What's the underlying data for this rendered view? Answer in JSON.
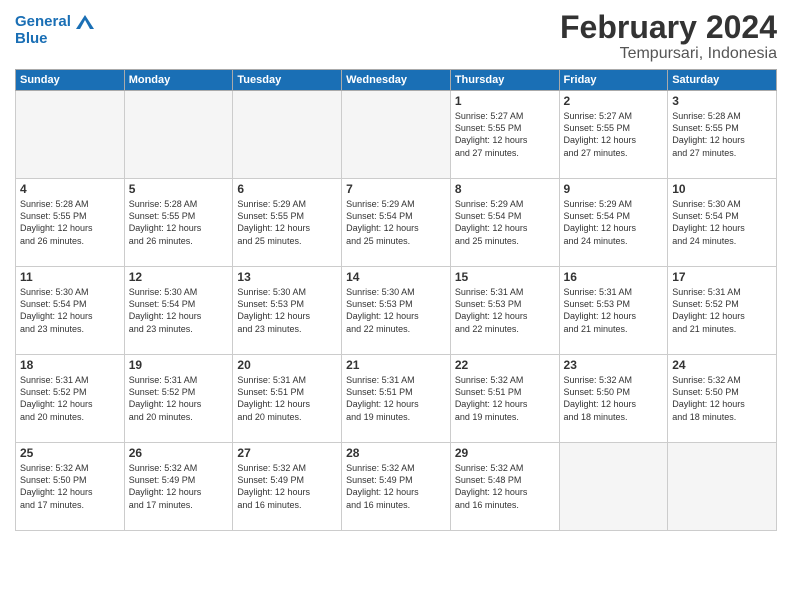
{
  "header": {
    "logo_line1": "General",
    "logo_line2": "Blue",
    "month": "February 2024",
    "location": "Tempursari, Indonesia"
  },
  "weekdays": [
    "Sunday",
    "Monday",
    "Tuesday",
    "Wednesday",
    "Thursday",
    "Friday",
    "Saturday"
  ],
  "weeks": [
    [
      {
        "day": "",
        "info": ""
      },
      {
        "day": "",
        "info": ""
      },
      {
        "day": "",
        "info": ""
      },
      {
        "day": "",
        "info": ""
      },
      {
        "day": "1",
        "info": "Sunrise: 5:27 AM\nSunset: 5:55 PM\nDaylight: 12 hours\nand 27 minutes."
      },
      {
        "day": "2",
        "info": "Sunrise: 5:27 AM\nSunset: 5:55 PM\nDaylight: 12 hours\nand 27 minutes."
      },
      {
        "day": "3",
        "info": "Sunrise: 5:28 AM\nSunset: 5:55 PM\nDaylight: 12 hours\nand 27 minutes."
      }
    ],
    [
      {
        "day": "4",
        "info": "Sunrise: 5:28 AM\nSunset: 5:55 PM\nDaylight: 12 hours\nand 26 minutes."
      },
      {
        "day": "5",
        "info": "Sunrise: 5:28 AM\nSunset: 5:55 PM\nDaylight: 12 hours\nand 26 minutes."
      },
      {
        "day": "6",
        "info": "Sunrise: 5:29 AM\nSunset: 5:55 PM\nDaylight: 12 hours\nand 25 minutes."
      },
      {
        "day": "7",
        "info": "Sunrise: 5:29 AM\nSunset: 5:54 PM\nDaylight: 12 hours\nand 25 minutes."
      },
      {
        "day": "8",
        "info": "Sunrise: 5:29 AM\nSunset: 5:54 PM\nDaylight: 12 hours\nand 25 minutes."
      },
      {
        "day": "9",
        "info": "Sunrise: 5:29 AM\nSunset: 5:54 PM\nDaylight: 12 hours\nand 24 minutes."
      },
      {
        "day": "10",
        "info": "Sunrise: 5:30 AM\nSunset: 5:54 PM\nDaylight: 12 hours\nand 24 minutes."
      }
    ],
    [
      {
        "day": "11",
        "info": "Sunrise: 5:30 AM\nSunset: 5:54 PM\nDaylight: 12 hours\nand 23 minutes."
      },
      {
        "day": "12",
        "info": "Sunrise: 5:30 AM\nSunset: 5:54 PM\nDaylight: 12 hours\nand 23 minutes."
      },
      {
        "day": "13",
        "info": "Sunrise: 5:30 AM\nSunset: 5:53 PM\nDaylight: 12 hours\nand 23 minutes."
      },
      {
        "day": "14",
        "info": "Sunrise: 5:30 AM\nSunset: 5:53 PM\nDaylight: 12 hours\nand 22 minutes."
      },
      {
        "day": "15",
        "info": "Sunrise: 5:31 AM\nSunset: 5:53 PM\nDaylight: 12 hours\nand 22 minutes."
      },
      {
        "day": "16",
        "info": "Sunrise: 5:31 AM\nSunset: 5:53 PM\nDaylight: 12 hours\nand 21 minutes."
      },
      {
        "day": "17",
        "info": "Sunrise: 5:31 AM\nSunset: 5:52 PM\nDaylight: 12 hours\nand 21 minutes."
      }
    ],
    [
      {
        "day": "18",
        "info": "Sunrise: 5:31 AM\nSunset: 5:52 PM\nDaylight: 12 hours\nand 20 minutes."
      },
      {
        "day": "19",
        "info": "Sunrise: 5:31 AM\nSunset: 5:52 PM\nDaylight: 12 hours\nand 20 minutes."
      },
      {
        "day": "20",
        "info": "Sunrise: 5:31 AM\nSunset: 5:51 PM\nDaylight: 12 hours\nand 20 minutes."
      },
      {
        "day": "21",
        "info": "Sunrise: 5:31 AM\nSunset: 5:51 PM\nDaylight: 12 hours\nand 19 minutes."
      },
      {
        "day": "22",
        "info": "Sunrise: 5:32 AM\nSunset: 5:51 PM\nDaylight: 12 hours\nand 19 minutes."
      },
      {
        "day": "23",
        "info": "Sunrise: 5:32 AM\nSunset: 5:50 PM\nDaylight: 12 hours\nand 18 minutes."
      },
      {
        "day": "24",
        "info": "Sunrise: 5:32 AM\nSunset: 5:50 PM\nDaylight: 12 hours\nand 18 minutes."
      }
    ],
    [
      {
        "day": "25",
        "info": "Sunrise: 5:32 AM\nSunset: 5:50 PM\nDaylight: 12 hours\nand 17 minutes."
      },
      {
        "day": "26",
        "info": "Sunrise: 5:32 AM\nSunset: 5:49 PM\nDaylight: 12 hours\nand 17 minutes."
      },
      {
        "day": "27",
        "info": "Sunrise: 5:32 AM\nSunset: 5:49 PM\nDaylight: 12 hours\nand 16 minutes."
      },
      {
        "day": "28",
        "info": "Sunrise: 5:32 AM\nSunset: 5:49 PM\nDaylight: 12 hours\nand 16 minutes."
      },
      {
        "day": "29",
        "info": "Sunrise: 5:32 AM\nSunset: 5:48 PM\nDaylight: 12 hours\nand 16 minutes."
      },
      {
        "day": "",
        "info": ""
      },
      {
        "day": "",
        "info": ""
      }
    ]
  ]
}
